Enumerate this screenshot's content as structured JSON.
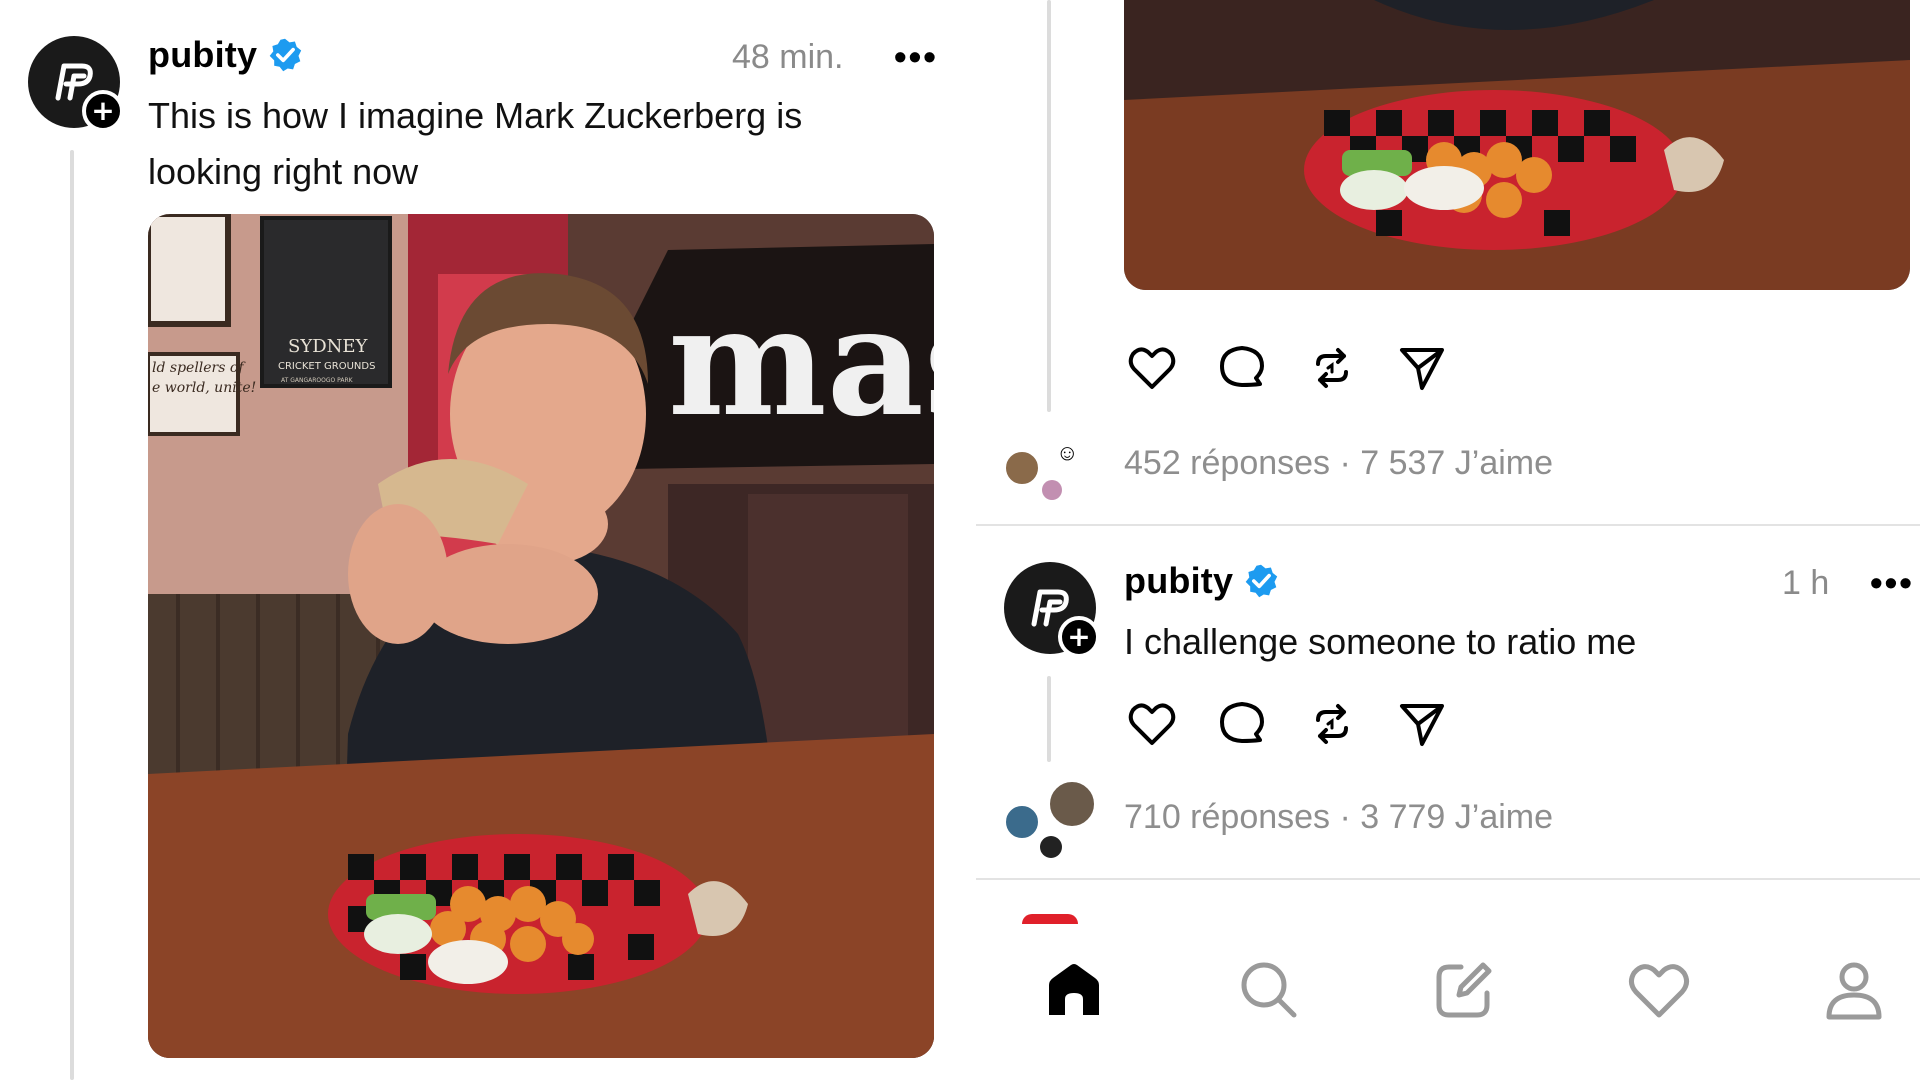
{
  "left_post": {
    "username": "pubity",
    "time": "48 min.",
    "more": "•••",
    "text_line1": "This is how I imagine Mark Zuckerberg is",
    "text_line2": "looking right now",
    "photo_signs": {
      "sydney": "SYDNEY",
      "cricket": "CRICKET GROUNDS",
      "park": "AT GANGAROOGO PARK",
      "spellers1": "ld spellers of",
      "spellers2": "e world, unite!"
    }
  },
  "right_post_top": {
    "stats": "452 réponses · 7 537 J’aime"
  },
  "right_post_second": {
    "username": "pubity",
    "time": "1 h",
    "more": "•••",
    "text": "I challenge someone to ratio me",
    "stats": "710 réponses · 3 779 J’aime"
  },
  "icons": {
    "like": "heart-icon",
    "comment": "comment-icon",
    "repost": "repost-icon",
    "share": "share-icon",
    "verified": "verified-badge-icon"
  },
  "nav": [
    "home-icon",
    "search-icon",
    "compose-icon",
    "activity-heart-icon",
    "profile-icon"
  ],
  "colors": {
    "verified": "#1d9bf0",
    "muted": "#8e8e8e",
    "divider": "#e3e3e3"
  }
}
